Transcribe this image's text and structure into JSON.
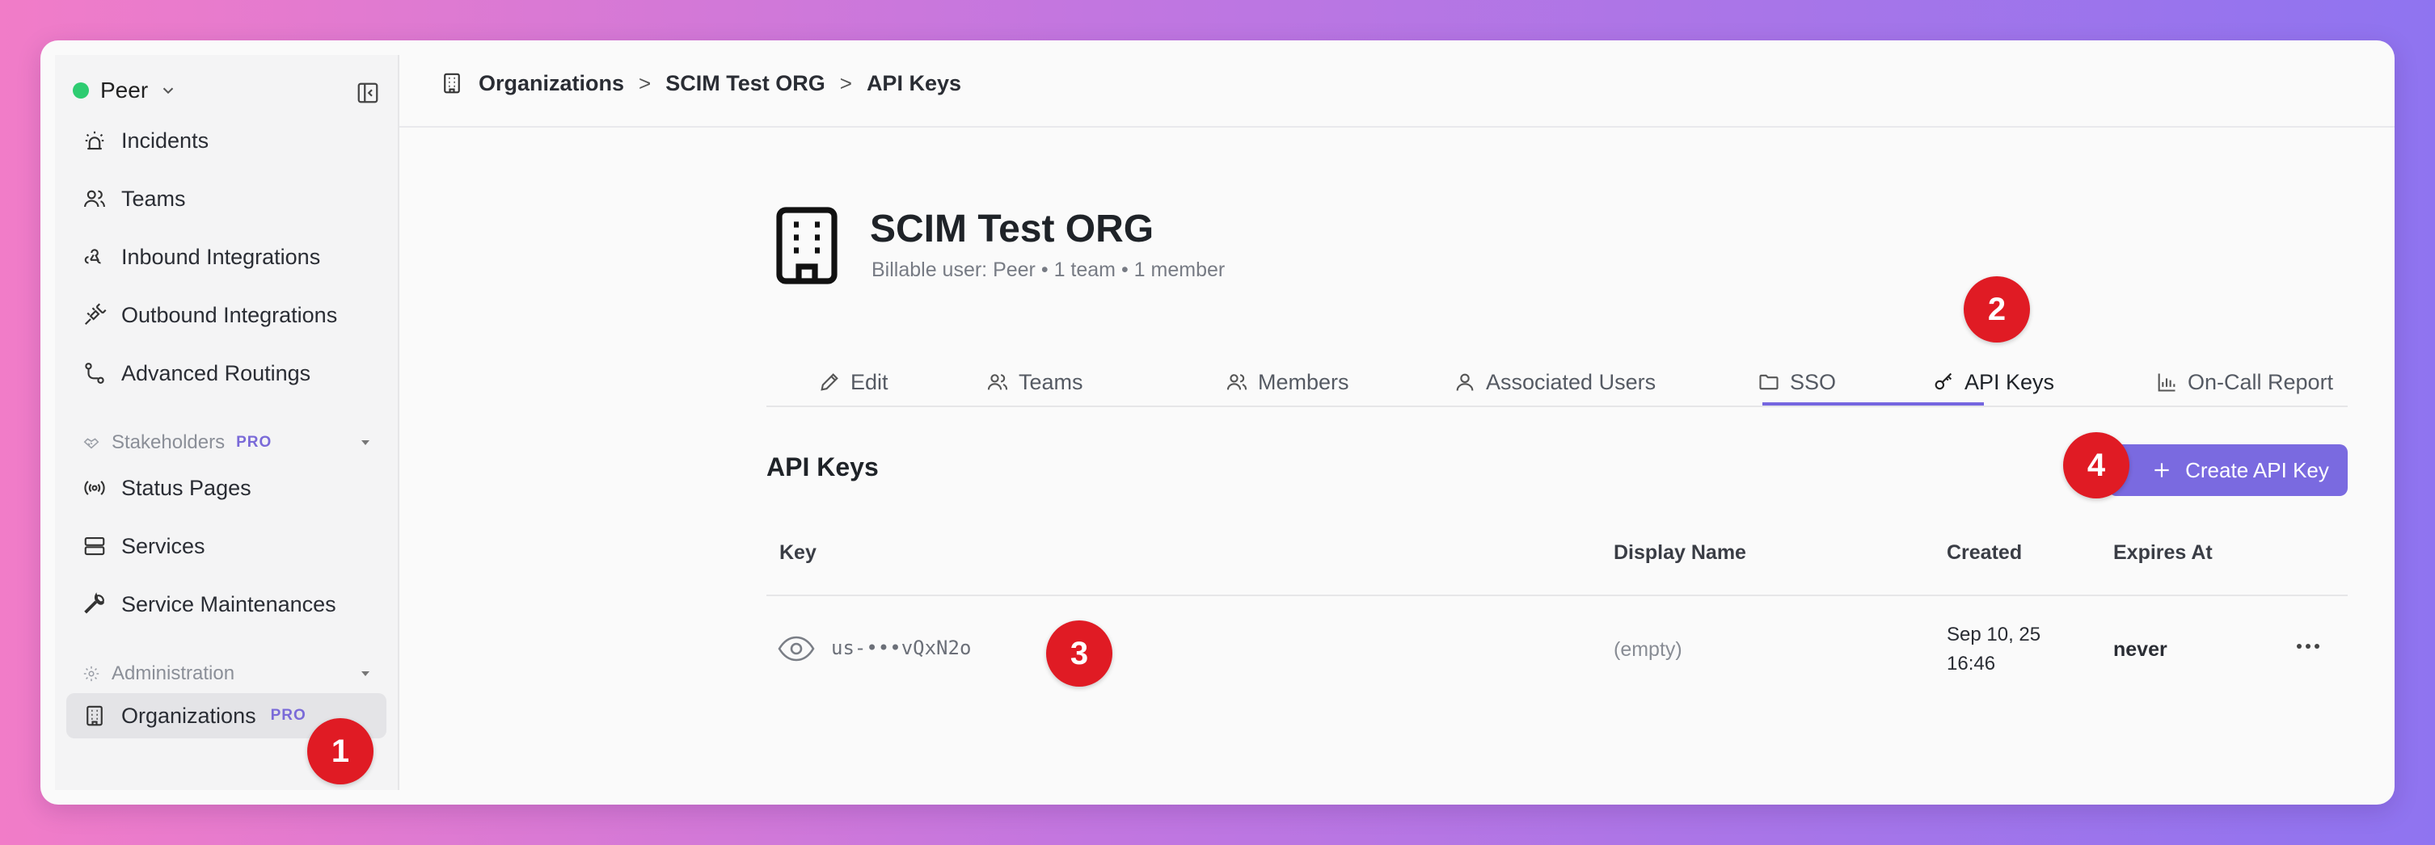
{
  "workspace": {
    "name": "Peer",
    "status_color": "#2ecc71"
  },
  "sidebar": {
    "items": [
      {
        "label": "Incidents",
        "icon": "alarm-icon"
      },
      {
        "label": "Teams",
        "icon": "users-icon"
      },
      {
        "label": "Inbound Integrations",
        "icon": "webhook-icon"
      },
      {
        "label": "Outbound Integrations",
        "icon": "plug-icon"
      },
      {
        "label": "Advanced Routings",
        "icon": "route-icon"
      }
    ],
    "stakeholders": {
      "title": "Stakeholders",
      "badge": "PRO",
      "items": [
        {
          "label": "Status Pages",
          "icon": "broadcast-icon"
        },
        {
          "label": "Services",
          "icon": "server-icon"
        },
        {
          "label": "Service Maintenances",
          "icon": "wrench-icon"
        }
      ]
    },
    "administration": {
      "title": "Administration",
      "items": [
        {
          "label": "Organizations",
          "badge": "PRO",
          "icon": "building-icon"
        }
      ]
    }
  },
  "breadcrumb": {
    "items": [
      "Organizations",
      "SCIM Test ORG",
      "API Keys"
    ],
    "separator": ">"
  },
  "org": {
    "name": "SCIM Test ORG",
    "billable_user": "Billable user: Peer",
    "teams": "1 team",
    "members": "1 member",
    "bullet": "•"
  },
  "tabs": [
    {
      "label": "Edit",
      "icon": "pencil-icon"
    },
    {
      "label": "Teams",
      "icon": "users-icon"
    },
    {
      "label": "Members",
      "icon": "users-icon"
    },
    {
      "label": "Associated Users",
      "icon": "user-icon"
    },
    {
      "label": "SSO",
      "icon": "folder-icon"
    },
    {
      "label": "API Keys",
      "icon": "key-icon",
      "active": true
    },
    {
      "label": "On-Call Report",
      "icon": "bar-chart-icon"
    }
  ],
  "api_keys": {
    "title": "API Keys",
    "create_label": "Create API Key",
    "columns": [
      "Key",
      "Display Name",
      "Created",
      "Expires At"
    ],
    "rows": [
      {
        "key": "us-•••vQxN2o",
        "display_name": "(empty)",
        "created_date": "Sep 10, 25",
        "created_time": "16:46",
        "expires": "never"
      }
    ]
  },
  "annotations": [
    "1",
    "2",
    "3",
    "4"
  ],
  "colors": {
    "accent": "#7a6ae0",
    "badge": "#e01b24",
    "status": "#2ecc71"
  }
}
